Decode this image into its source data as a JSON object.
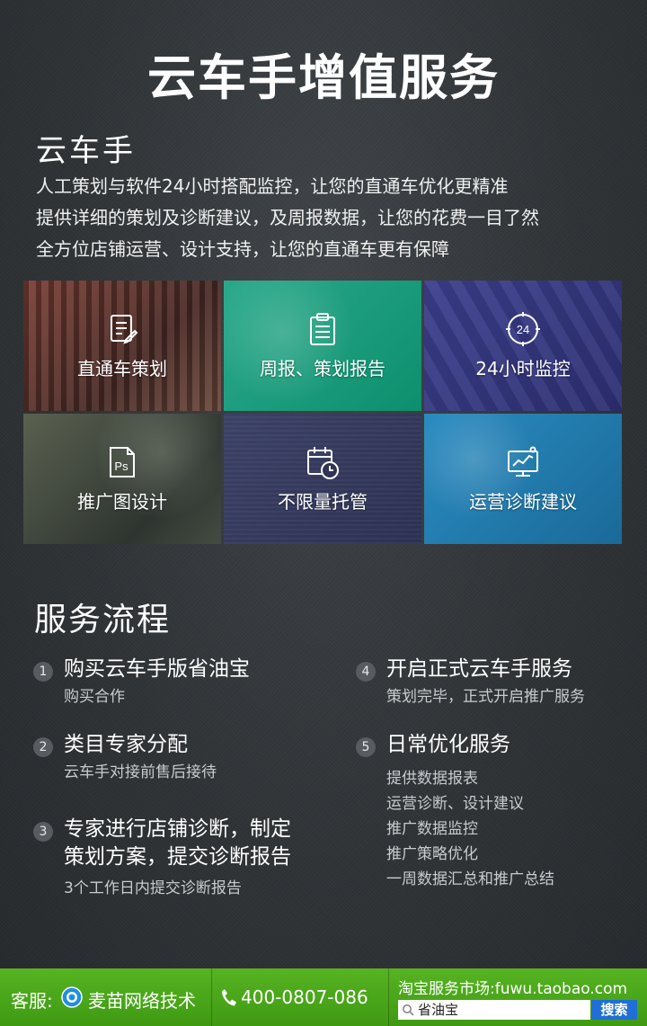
{
  "title": "云车手增值服务",
  "brand": "云车手",
  "intro": [
    "人工策划与软件24小时搭配监控，让您的直通车优化更精准",
    "提供详细的策划及诊断建议，及周报数据，让您的花费一目了然",
    "全方位店铺运营、设计支持，让您的直通车更有保障"
  ],
  "tiles": [
    {
      "label": "直通车策划",
      "icon": "document-edit-icon"
    },
    {
      "label": "周报、策划报告",
      "icon": "clipboard-icon"
    },
    {
      "label": "24小时监控",
      "icon": "clock-24-icon",
      "icon_text": "24"
    },
    {
      "label": "推广图设计",
      "icon": "photoshop-icon",
      "icon_text": "Ps"
    },
    {
      "label": "不限量托管",
      "icon": "calendar-clock-icon"
    },
    {
      "label": "运营诊断建议",
      "icon": "chart-monitor-icon"
    }
  ],
  "flow": {
    "heading": "服务流程",
    "steps": [
      {
        "num": "1",
        "title": [
          "购买云车手版省油宝"
        ],
        "desc": [
          "购买合作"
        ]
      },
      {
        "num": "2",
        "title": [
          "类目专家分配"
        ],
        "desc": [
          "云车手对接前售后接待"
        ]
      },
      {
        "num": "3",
        "title": [
          "专家进行店铺诊断，制定",
          "策划方案，提交诊断报告"
        ],
        "desc": [
          "3个工作日内提交诊断报告"
        ]
      },
      {
        "num": "4",
        "title": [
          "开启正式云车手服务"
        ],
        "desc": [
          "策划完毕，正式开启推广服务"
        ]
      },
      {
        "num": "5",
        "title": [
          "日常优化服务"
        ],
        "desc": [
          "提供数据报表",
          "运营诊断、设计建议",
          "推广数据监控",
          "推广策略优化",
          "一周数据汇总和推广总结"
        ]
      }
    ]
  },
  "footer": {
    "service_label": "客服:",
    "company": "麦苗网络技术",
    "phone": "400-0807-086",
    "market": "淘宝服务市场:fuwu.taobao.com",
    "search_value": "省油宝",
    "search_button": "搜索"
  },
  "colors": {
    "footer_green": "#4aa618",
    "tile_teal": "#1a9c7c",
    "tile_indigo": "#35388a",
    "tile_blue": "#2283bb",
    "search_blue": "#1f6fd6"
  }
}
